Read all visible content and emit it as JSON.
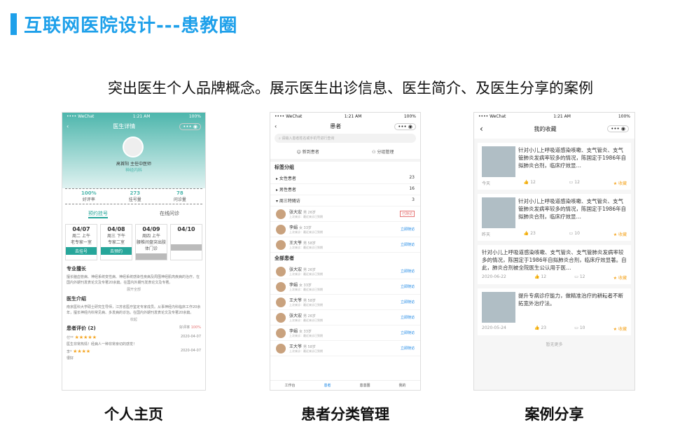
{
  "title": "互联网医院设计---患教圈",
  "subtitle": "突出医生个人品牌概念。展示医生出诊信息、医生简介、及医生分享的案例",
  "captions": [
    "个人主页",
    "患者分类管理",
    "案例分享"
  ],
  "p1": {
    "status": [
      "•••• WeChat",
      "1:21 AM",
      "100%"
    ],
    "nav_title": "医生详情",
    "doctor_name": "高首阳  主任中医师",
    "dept": "神经内科",
    "stats": [
      {
        "v": "100%",
        "l": "好评率"
      },
      {
        "v": "273",
        "l": "挂号量"
      },
      {
        "v": "78",
        "l": "问诊量"
      }
    ],
    "tabs": [
      "预约挂号",
      "在线问诊"
    ],
    "dates": [
      {
        "d": "04/07",
        "w": "周二 上午",
        "t": "老专家一室",
        "b": "去挂号"
      },
      {
        "d": "04/08",
        "w": "周三 下午",
        "t": "专家二室",
        "b": "去预约"
      },
      {
        "d": "04/09",
        "w": "周四 上午",
        "t": "腰椎间盘突出肢体门诊",
        "b": ""
      },
      {
        "d": "04/10",
        "w": "",
        "t": "",
        "b": ""
      }
    ],
    "sec1": "专业擅长",
    "sec1_text": "擅长脑血管病、神经系统变性病、神经系统感染性疾病及周围神经肌肉疾病的治疗。在国内外期刊发表论文及专著20余篇。在国内外期刊发表论文及专著。",
    "more1": "展开全部",
    "sec2": "医生介绍",
    "sec2_text": "南京医科大学硕士研究生导师，江苏省医疗鉴定专家成员。从事神经内科临床工作20余年，擅长神经内科常见病、多发病的诊治。在国内外期刊发表论文及专著20余篇。",
    "more2": "收起",
    "sec3": "患者评价",
    "sec3_count": "(2)",
    "rate_label": "好评率",
    "rate": "100%",
    "reviews": [
      {
        "u": "付**",
        "d": "2020-04-07",
        "t": "医生非常热情！经病人一种非常亲切的感觉！"
      },
      {
        "u": "李*",
        "d": "2020-04-07",
        "t": "很好"
      }
    ]
  },
  "p2": {
    "status": [
      "•••• WeChat",
      "1:21 AM",
      "100%"
    ],
    "nav_title": "患者",
    "search": "请输入患者姓名或手机号进行查询",
    "actions": [
      "新到患者",
      "分组管理"
    ],
    "g1": "标签分组",
    "groups": [
      {
        "n": "女性患者",
        "c": "23"
      },
      {
        "n": "男性患者",
        "c": "16"
      },
      {
        "n": "周三特随访",
        "c": "3"
      }
    ],
    "pats1": [
      {
        "n": "张大宏",
        "s": "男  26岁",
        "a": "已随访",
        "red": true
      },
      {
        "n": "李娟",
        "s": "女  33岁",
        "a": "立即随访",
        "red": false
      },
      {
        "n": "王大爷",
        "s": "男  58岁",
        "a": "立即随访",
        "red": false
      }
    ],
    "g2": "全部患者",
    "pats2": [
      {
        "n": "张大宏",
        "s": "男  26岁",
        "a": "立即随访"
      },
      {
        "n": "李娟",
        "s": "女  33岁",
        "a": "立即随访"
      },
      {
        "n": "王大爷",
        "s": "男  58岁",
        "a": "立即随访"
      },
      {
        "n": "张大宏",
        "s": "男  26岁",
        "a": "立即随访"
      },
      {
        "n": "李娟",
        "s": "女  33岁",
        "a": "立即随访"
      },
      {
        "n": "王大爷",
        "s": "男  58岁",
        "a": "立即随访"
      }
    ],
    "bnav": [
      "工作台",
      "患者",
      "患患圈",
      "我的"
    ]
  },
  "p3": {
    "status": [
      "•••• WeChat",
      "1:21 AM",
      "100%"
    ],
    "nav_title": "我的收藏",
    "cards": [
      {
        "text": "针对小儿上呼吸道感染咳嗽、支气管炎、支气管肺炎发病率较多的情况，陈国定于1986年自拟肺炎合剂，临床疗效显…",
        "date": "今天",
        "likes": "12",
        "comments": "12",
        "coll": "收藏",
        "img": true
      },
      {
        "text": "针对小儿上呼吸道感染咳嗽、支气管炎、支气管肺炎发病率较多的情况，陈国定于1986年自拟肺炎合剂，临床疗效显…",
        "date": "昨天",
        "likes": "23",
        "comments": "10",
        "coll": "收藏",
        "img": true
      },
      {
        "text": "针对小儿上呼吸道感染咳嗽、支气管炎、支气管肺炎发病率较多的情况，陈国定于1986年自拟肺炎合剂，临床疗效显著。自此，肺炎合剂被全院医生公认用于医…",
        "date": "2020-06-22",
        "likes": "12",
        "comments": "12",
        "coll": "收藏",
        "img": false
      },
      {
        "text": "提升专病诊疗能力，做精准治疗的耕耘者不断拓宽外治疗法。",
        "date": "2020-05-24",
        "likes": "23",
        "comments": "10",
        "coll": "收藏",
        "img": true
      }
    ],
    "nomore": "暂无更多"
  }
}
